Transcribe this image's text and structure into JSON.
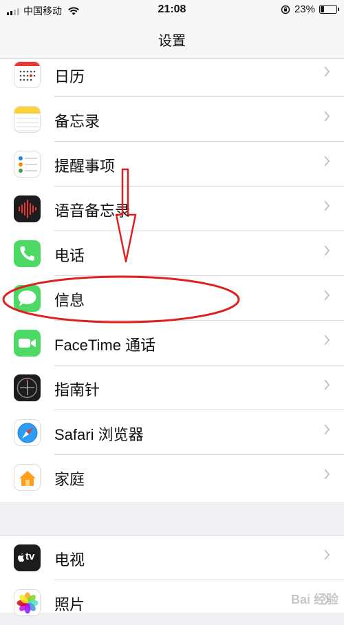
{
  "status": {
    "carrier": "中国移动",
    "time": "21:08",
    "battery": "23%"
  },
  "nav": {
    "title": "设置"
  },
  "items": [
    {
      "label": "日历",
      "icon": "calendar-icon"
    },
    {
      "label": "备忘录",
      "icon": "notes-icon"
    },
    {
      "label": "提醒事项",
      "icon": "reminders-icon"
    },
    {
      "label": "语音备忘录",
      "icon": "voice-memos-icon"
    },
    {
      "label": "电话",
      "icon": "phone-icon"
    },
    {
      "label": "信息",
      "icon": "messages-icon"
    },
    {
      "label": "FaceTime 通话",
      "icon": "facetime-icon"
    },
    {
      "label": "指南针",
      "icon": "compass-icon"
    },
    {
      "label": "Safari 浏览器",
      "icon": "safari-icon"
    },
    {
      "label": "家庭",
      "icon": "home-icon"
    }
  ],
  "items2": [
    {
      "label": "电视",
      "icon": "tv-icon",
      "badge": "tv"
    },
    {
      "label": "照片",
      "icon": "photos-icon"
    }
  ],
  "watermark": "Bai 经验",
  "colors": {
    "green": "#4cd964",
    "red_annotation": "#e02020",
    "chevron": "#c4c4c7"
  }
}
